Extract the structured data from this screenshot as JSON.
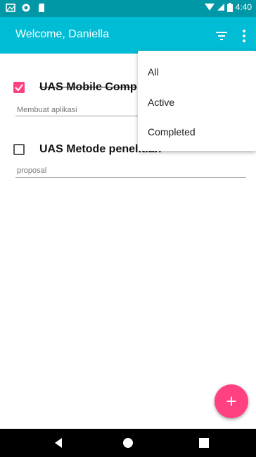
{
  "status_bar": {
    "time": "4:40",
    "icons": [
      "gallery-icon",
      "record-icon",
      "sd-card-icon",
      "wifi-icon",
      "signal-icon",
      "battery-icon"
    ]
  },
  "app_bar": {
    "title": "Welcome, Daniella",
    "icons": [
      "filter-icon",
      "more-vert-icon"
    ]
  },
  "todos": [
    {
      "title": "UAS Mobile Comp",
      "description": "Membuat aplikasi",
      "completed": true
    },
    {
      "title": "UAS Metode penelitian",
      "description": "proposal",
      "completed": false
    }
  ],
  "filter_menu": {
    "items": [
      "All",
      "Active",
      "Completed"
    ]
  },
  "fab": {
    "label": "+"
  },
  "colors": {
    "primary": "#00bcd4",
    "primary_dark": "#0097a7",
    "accent": "#ff4081"
  }
}
